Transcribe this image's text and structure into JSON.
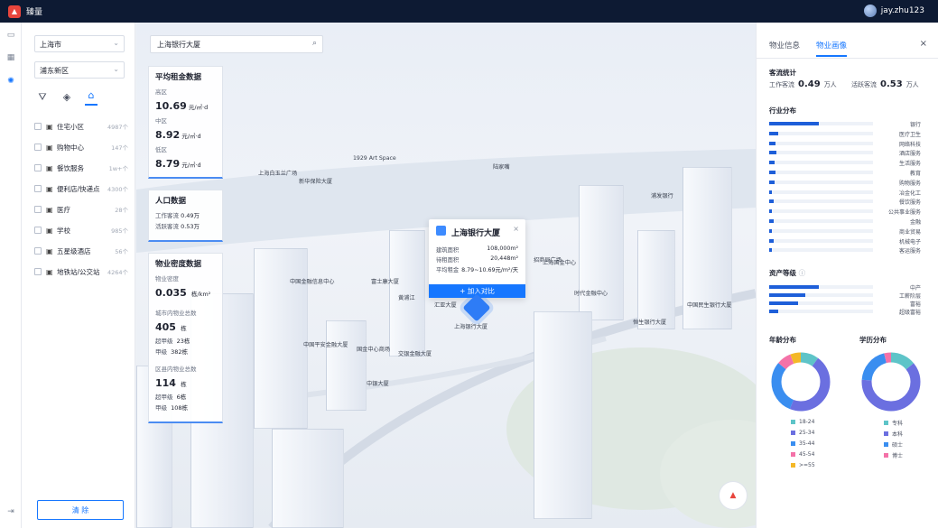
{
  "app": {
    "name": "臻量",
    "user": "jay.zhu123"
  },
  "filters": {
    "city": "上海市",
    "district": "浦东新区"
  },
  "categories": [
    {
      "label": "住宅小区",
      "count": "4987个",
      "icon": "home-icon"
    },
    {
      "label": "购物中心",
      "count": "147个",
      "icon": "shop-icon"
    },
    {
      "label": "餐饮服务",
      "count": "1w+个",
      "icon": "food-icon"
    },
    {
      "label": "便利店/快递点",
      "count": "4300个",
      "icon": "store-icon"
    },
    {
      "label": "医疗",
      "count": "28个",
      "icon": "hospital-icon"
    },
    {
      "label": "学校",
      "count": "985个",
      "icon": "school-icon"
    },
    {
      "label": "五星级酒店",
      "count": "56个",
      "icon": "hotel-icon"
    },
    {
      "label": "地铁站/公交站",
      "count": "4264个",
      "icon": "metro-icon"
    }
  ],
  "clear_label": "清 除",
  "search": {
    "value": "上海银行大厦"
  },
  "rent_card": {
    "title": "平均租金数据",
    "items": [
      {
        "label": "高区",
        "value": "10.69",
        "unit": "元/㎡·d"
      },
      {
        "label": "中区",
        "value": "8.92",
        "unit": "元/㎡·d"
      },
      {
        "label": "低区",
        "value": "8.79",
        "unit": "元/㎡·d"
      }
    ]
  },
  "population_card": {
    "title": "人口数据",
    "rows": [
      {
        "label": "工作客流",
        "value": "0.49万"
      },
      {
        "label": "活跃客流",
        "value": "0.53万"
      }
    ]
  },
  "density_card": {
    "title": "物业密度数据",
    "density_label": "物业密度",
    "density_value": "0.035",
    "density_unit": "栋/km²",
    "city_label": "城市内物业总数",
    "city_value": "405",
    "city_unit": "栋",
    "city_rows": [
      {
        "label": "超甲级",
        "value": "23栋"
      },
      {
        "label": "甲级",
        "value": "382栋"
      }
    ],
    "district_label": "区县内物业总数",
    "district_value": "114",
    "district_unit": "栋",
    "district_rows": [
      {
        "label": "超甲级",
        "value": "6栋"
      },
      {
        "label": "甲级",
        "value": "108栋"
      }
    ]
  },
  "popup": {
    "title": "上海银行大厦",
    "rows": [
      {
        "label": "建筑面积",
        "value": "108,000m²"
      },
      {
        "label": "待租面积",
        "value": "20,448m²"
      },
      {
        "label": "平均租金",
        "value": "8.79~10.69元/m²/天"
      }
    ],
    "button": "+ 加入对比"
  },
  "map_labels": [
    "上海银行大厦",
    "中国金融信息中心",
    "富士康大厦",
    "国金中心商场",
    "中国平安金融大厦",
    "时代金融中心",
    "恒生银行大厦",
    "东方明珠",
    "浦发银行",
    "上海国金中心",
    "交银金融大厦",
    "汇亚大厦",
    "黄浦江",
    "陆家嘴",
    "新华保险大厦",
    "中银大厦",
    "上海白玉兰广场",
    "招商局广场",
    "中国民生银行大厦",
    "1929 Art Space"
  ],
  "right": {
    "tabs": [
      "物业信息",
      "物业画像"
    ],
    "active_tab": 1,
    "flow_title": "客流统计",
    "work_flow_label": "工作客流",
    "work_flow_value": "0.49",
    "active_flow_label": "活跃客流",
    "active_flow_value": "0.53",
    "flow_unit": "万人",
    "industry_title": "行业分布",
    "industries": [
      {
        "label": "银行",
        "value": 0.48
      },
      {
        "label": "医疗卫生",
        "value": 0.09
      },
      {
        "label": "网络科技",
        "value": 0.06
      },
      {
        "label": "酒店服务",
        "value": 0.07
      },
      {
        "label": "生活服务",
        "value": 0.05
      },
      {
        "label": "教育",
        "value": 0.06
      },
      {
        "label": "购物服务",
        "value": 0.05
      },
      {
        "label": "冶金化工",
        "value": 0.03
      },
      {
        "label": "餐饮服务",
        "value": 0.04
      },
      {
        "label": "公共事业服务",
        "value": 0.03
      },
      {
        "label": "金融",
        "value": 0.04
      },
      {
        "label": "商业贸易",
        "value": 0.03
      },
      {
        "label": "机械电子",
        "value": 0.04
      },
      {
        "label": "客运服务",
        "value": 0.03
      }
    ],
    "asset_title": "资产等级",
    "assets": [
      {
        "label": "中产",
        "value": 0.48
      },
      {
        "label": "工薪阶层",
        "value": 0.35
      },
      {
        "label": "富裕",
        "value": 0.28
      },
      {
        "label": "超级富裕",
        "value": 0.09
      }
    ],
    "age_title": "年龄分布",
    "age": [
      {
        "label": "18-24",
        "value": 10,
        "color": "#5ec4c8"
      },
      {
        "label": "25-34",
        "value": 46,
        "color": "#6b6fe0"
      },
      {
        "label": "35-44",
        "value": 30,
        "color": "#3a8ef0"
      },
      {
        "label": "45-54",
        "value": 8,
        "color": "#f472a8"
      },
      {
        "label": ">=55",
        "value": 6,
        "color": "#f4b828"
      }
    ],
    "edu_title": "学历分布",
    "edu": [
      {
        "label": "专科",
        "value": 14,
        "color": "#5ec4c8"
      },
      {
        "label": "本科",
        "value": 62,
        "color": "#6b6fe0"
      },
      {
        "label": "硕士",
        "value": 20,
        "color": "#3a8ef0"
      },
      {
        "label": "博士",
        "value": 4,
        "color": "#f472a8"
      }
    ]
  }
}
